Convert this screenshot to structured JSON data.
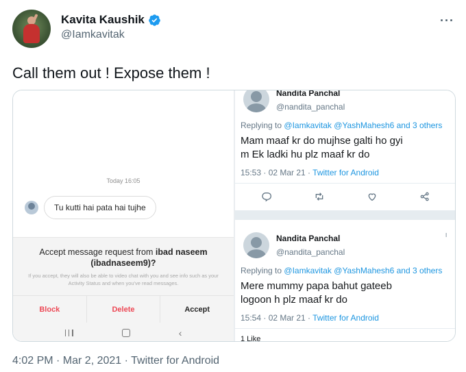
{
  "author": {
    "display_name": "Kavita Kaushik",
    "handle": "@Iamkavitak",
    "verified": true,
    "avatar_icon": "profile-photo-dancer"
  },
  "tweet": {
    "text": "Call them out ! Expose them !",
    "more_icon": "ellipsis-icon",
    "footer": "4:02 PM · Mar 2, 2021 · Twitter for Android"
  },
  "dm": {
    "time": "Today 16:05",
    "message": "Tu kutti hai pata hai tujhe",
    "request_prefix": "Accept message request from",
    "request_name": "ibad naseem",
    "request_handle": "(ibadnaseem9)?",
    "request_info": "If you accept, they will also be able to video chat with you and see info such as your Activity Status and when you've read messages.",
    "buttons": {
      "block": "Block",
      "delete": "Delete",
      "accept": "Accept"
    }
  },
  "reply1": {
    "name_partial": "Nandita Panchal",
    "handle": "@nandita_panchal",
    "replying_prefix": "Replying to",
    "replying_targets": "@Iamkavitak @YashMahesh6 and 3 others",
    "body_line1": "Mam maaf kr do mujhse galti ho gyi",
    "body_line2": "m Ek ladki hu plz maaf kr do",
    "time": "15:53 · 02 Mar 21 · ",
    "source": "Twitter for Android"
  },
  "reply2": {
    "name": "Nandita Panchal",
    "handle": "@nandita_panchal",
    "replying_prefix": "Replying to",
    "replying_targets": "@Iamkavitak @YashMahesh6 and 3 others",
    "body_line1": "Mere mummy papa bahut gateeb",
    "body_line2": "logoon h plz maaf kr do",
    "time": "15:54 · 02 Mar 21 · ",
    "source": "Twitter for Android",
    "likes": "1 Like"
  },
  "colors": {
    "link": "#1b95e0",
    "verified": "#1d9bf0",
    "instagram_red": "#ed4956",
    "secondary_text": "#536471"
  }
}
